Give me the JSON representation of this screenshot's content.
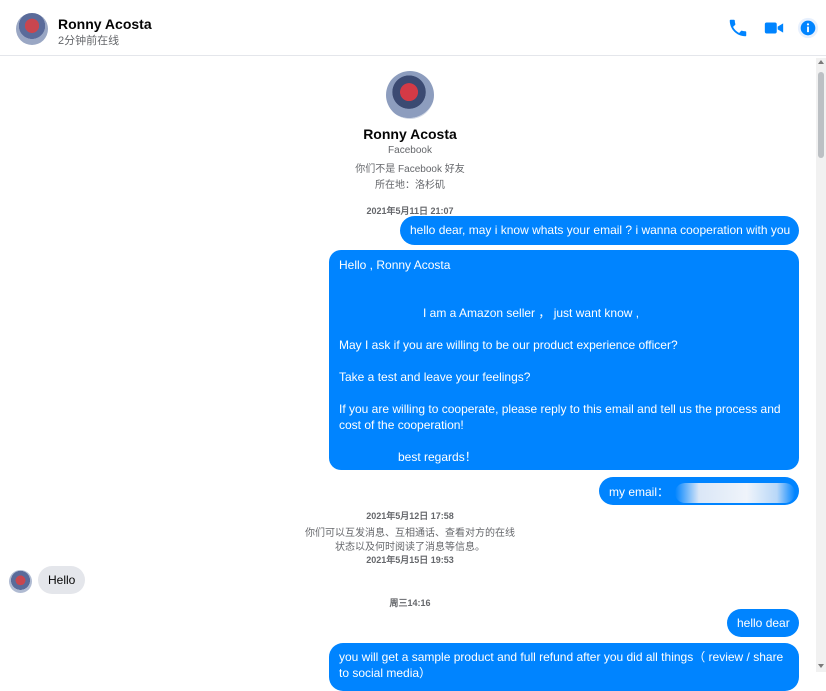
{
  "header": {
    "name": "Ronny Acosta",
    "status": "2分钟前在线",
    "icons": [
      "phone-icon",
      "video-camera-icon",
      "info-icon"
    ],
    "accent": "#0084ff"
  },
  "profile": {
    "name": "Ronny Acosta",
    "source": "Facebook",
    "friend_status": "你们不是 Facebook 好友",
    "location": "所在地：洛杉矶"
  },
  "timestamps": {
    "t1": "2021年5月11日 21:07",
    "t2": "2021年5月12日 17:58",
    "t3": "2021年5月15日 19:53",
    "t4": "周三14:16"
  },
  "notice": {
    "line1": "你们可以互发消息、互相通话、查看对方的在线",
    "line2": "状态以及何时阅读了消息等信息。"
  },
  "messages": {
    "m1": "hello dear, may i know whats your email ? i wanna cooperation with you",
    "m2": {
      "l1": "Hello , Ronny Acosta",
      "l2": "I am a Amazon seller ， just want know ,",
      "l3": "May I ask if you are willing to be our product experience officer?",
      "l4": "Take a test and leave your feelings?",
      "l5": "If you are willing to cooperate, please reply to this email and tell us the process and",
      "l6": "cost of the cooperation!",
      "l7": "best regards！"
    },
    "m3": "my email：",
    "m4": "Hello",
    "m5": "hello dear",
    "m6": "you will get a sample product and full refund after you did all things（ review / share",
    "m6b": "to social media）"
  },
  "colors": {
    "outgoing": "#0084ff",
    "incoming": "#e4e6eb"
  }
}
